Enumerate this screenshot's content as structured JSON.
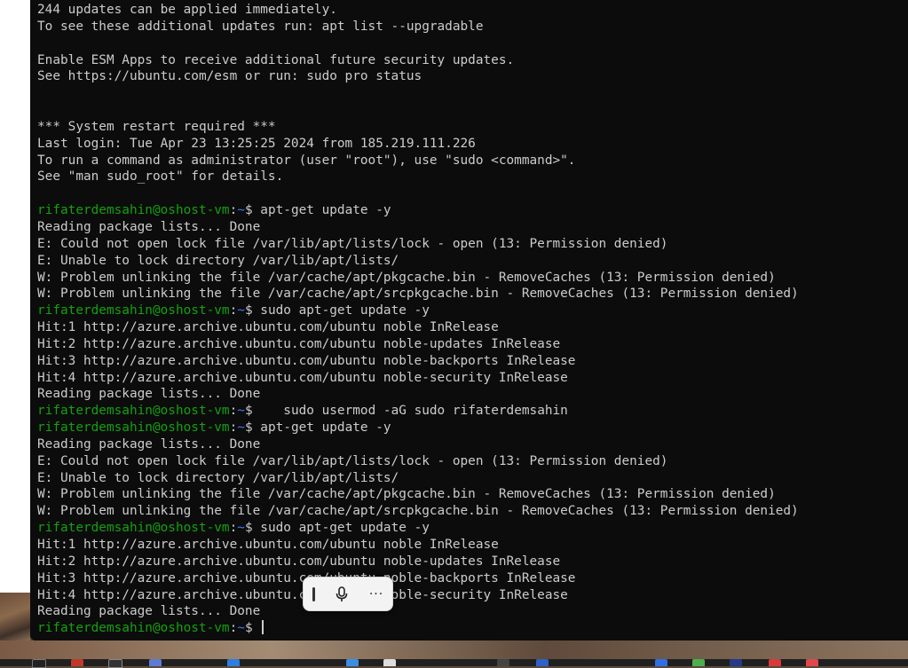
{
  "terminal": {
    "prompt": {
      "user_host": "rifaterdemsahin@oshost-vm",
      "path": "~",
      "symbol": "$"
    },
    "lines": [
      {
        "kind": "out",
        "text": "244 updates can be applied immediately."
      },
      {
        "kind": "out",
        "text": "To see these additional updates run: apt list --upgradable"
      },
      {
        "kind": "out",
        "text": ""
      },
      {
        "kind": "out",
        "text": "Enable ESM Apps to receive additional future security updates."
      },
      {
        "kind": "out",
        "text": "See https://ubuntu.com/esm or run: sudo pro status"
      },
      {
        "kind": "out",
        "text": ""
      },
      {
        "kind": "out",
        "text": ""
      },
      {
        "kind": "out",
        "text": "*** System restart required ***"
      },
      {
        "kind": "out",
        "text": "Last login: Tue Apr 23 13:25:25 2024 from 185.219.111.226"
      },
      {
        "kind": "out",
        "text": "To run a command as administrator (user \"root\"), use \"sudo <command>\"."
      },
      {
        "kind": "out",
        "text": "See \"man sudo_root\" for details."
      },
      {
        "kind": "out",
        "text": ""
      },
      {
        "kind": "cmd",
        "text": " apt-get update -y"
      },
      {
        "kind": "out",
        "text": "Reading package lists... Done"
      },
      {
        "kind": "out",
        "text": "E: Could not open lock file /var/lib/apt/lists/lock - open (13: Permission denied)"
      },
      {
        "kind": "out",
        "text": "E: Unable to lock directory /var/lib/apt/lists/"
      },
      {
        "kind": "out",
        "text": "W: Problem unlinking the file /var/cache/apt/pkgcache.bin - RemoveCaches (13: Permission denied)"
      },
      {
        "kind": "out",
        "text": "W: Problem unlinking the file /var/cache/apt/srcpkgcache.bin - RemoveCaches (13: Permission denied)"
      },
      {
        "kind": "cmd",
        "text": " sudo apt-get update -y"
      },
      {
        "kind": "out",
        "text": "Hit:1 http://azure.archive.ubuntu.com/ubuntu noble InRelease"
      },
      {
        "kind": "out",
        "text": "Hit:2 http://azure.archive.ubuntu.com/ubuntu noble-updates InRelease"
      },
      {
        "kind": "out",
        "text": "Hit:3 http://azure.archive.ubuntu.com/ubuntu noble-backports InRelease"
      },
      {
        "kind": "out",
        "text": "Hit:4 http://azure.archive.ubuntu.com/ubuntu noble-security InRelease"
      },
      {
        "kind": "out",
        "text": "Reading package lists... Done"
      },
      {
        "kind": "cmd",
        "text": "    sudo usermod -aG sudo rifaterdemsahin"
      },
      {
        "kind": "cmd",
        "text": " apt-get update -y"
      },
      {
        "kind": "out",
        "text": "Reading package lists... Done"
      },
      {
        "kind": "out",
        "text": "E: Could not open lock file /var/lib/apt/lists/lock - open (13: Permission denied)"
      },
      {
        "kind": "out",
        "text": "E: Unable to lock directory /var/lib/apt/lists/"
      },
      {
        "kind": "out",
        "text": "W: Problem unlinking the file /var/cache/apt/pkgcache.bin - RemoveCaches (13: Permission denied)"
      },
      {
        "kind": "out",
        "text": "W: Problem unlinking the file /var/cache/apt/srcpkgcache.bin - RemoveCaches (13: Permission denied)"
      },
      {
        "kind": "cmd",
        "text": " sudo apt-get update -y"
      },
      {
        "kind": "out",
        "text": "Hit:1 http://azure.archive.ubuntu.com/ubuntu noble InRelease"
      },
      {
        "kind": "out",
        "text": "Hit:2 http://azure.archive.ubuntu.com/ubuntu noble-updates InRelease"
      },
      {
        "kind": "out",
        "text": "Hit:3 http://azure.archive.ubuntu.com/ubuntu noble-backports InRelease"
      },
      {
        "kind": "out",
        "text": "Hit:4 http://azure.archive.ubuntu.com/ubuntu noble-security InRelease"
      },
      {
        "kind": "out",
        "text": "Reading package lists... Done"
      },
      {
        "kind": "cmd",
        "text": " "
      }
    ]
  },
  "voice_toolbar": {
    "grip_icon": "drag-handle-icon",
    "mic_icon": "microphone-icon",
    "more_label": "···"
  },
  "colors": {
    "terminal_bg": "#0c0c0c",
    "text": "#cccccc",
    "prompt_user": "#13a10e",
    "prompt_path": "#3b78ff"
  }
}
